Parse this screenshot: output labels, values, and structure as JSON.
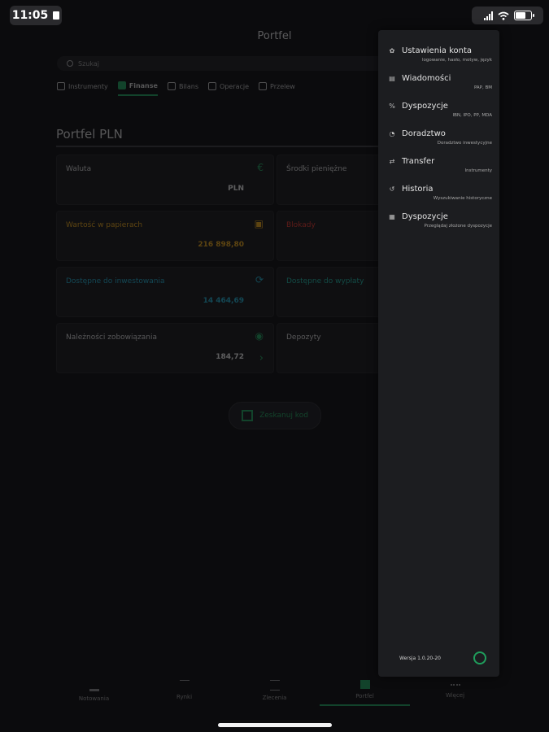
{
  "status_bar": {
    "time": "11:05"
  },
  "header": {
    "title": "Portfel"
  },
  "search": {
    "placeholder": "Szukaj"
  },
  "tabs": [
    {
      "label": "Instrumenty",
      "active": false
    },
    {
      "label": "Finanse",
      "active": true
    },
    {
      "label": "Bilans",
      "active": false
    },
    {
      "label": "Operacje",
      "active": false
    },
    {
      "label": "Przelew",
      "active": false
    }
  ],
  "section": {
    "title": "Portfel PLN"
  },
  "cards": {
    "waluta": {
      "label": "Waluta",
      "value": "PLN"
    },
    "srodki": {
      "label": "Środki pieniężne"
    },
    "wartosc": {
      "label": "Wartość w papierach",
      "value": "216 898,80"
    },
    "blokady": {
      "label": "Blokady"
    },
    "dostepne_inwestowanie": {
      "label": "Dostępne do inwestowania",
      "value": "14 464,69"
    },
    "dostepne_wyplaty": {
      "label": "Dostępne do wypłaty"
    },
    "naleznosci": {
      "label": "Należności zobowiązania",
      "value": "184,72"
    },
    "depozyty": {
      "label": "Depozyty"
    }
  },
  "qr_button": {
    "label": "Zeskanuj kod"
  },
  "bottom_nav": [
    {
      "label": "Notowania",
      "active": false
    },
    {
      "label": "Rynki",
      "active": false
    },
    {
      "label": "Zlecenia",
      "active": false
    },
    {
      "label": "Portfel",
      "active": true
    },
    {
      "label": "Więcej",
      "active": false
    }
  ],
  "menu": {
    "items": [
      {
        "label": "Ustawienia konta",
        "sub": "logowanie, hasło, motyw, język",
        "icon": "gear-icon"
      },
      {
        "label": "Wiadomości",
        "sub": "PAP, BM",
        "icon": "news-icon"
      },
      {
        "label": "Dyspozycje",
        "sub": "IBN, IPO, PP, MDA",
        "icon": "percent-icon"
      },
      {
        "label": "Doradztwo",
        "sub": "Doradztwo inwestycyjne",
        "icon": "advice-icon"
      },
      {
        "label": "Transfer",
        "sub": "Instrumenty",
        "icon": "transfer-icon"
      },
      {
        "label": "Historia",
        "sub": "Wyszukiwanie historyczne",
        "icon": "history-icon"
      },
      {
        "label": "Dyspozycje",
        "sub": "Przeglądaj złożone dyspozycje",
        "icon": "document-icon"
      }
    ],
    "version": "Wersja 1.0.20-20"
  },
  "colors": {
    "accent": "#1f9e5c",
    "orange": "#e3a21a",
    "teal": "#20a8c8",
    "red": "#e0352b",
    "panel": "#1c1d20"
  }
}
